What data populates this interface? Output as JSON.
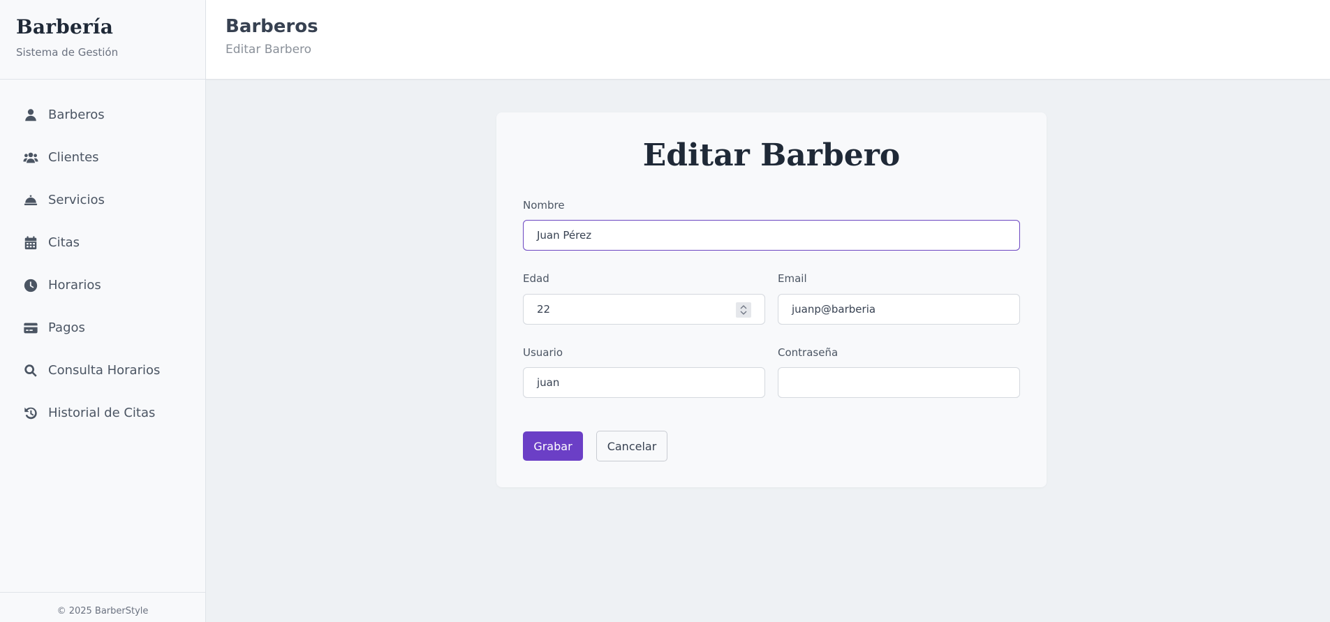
{
  "brand": {
    "title": "Barbería",
    "subtitle": "Sistema de Gestión"
  },
  "sidebar": {
    "items": [
      {
        "label": "Barberos",
        "icon": "user-icon"
      },
      {
        "label": "Clientes",
        "icon": "users-icon"
      },
      {
        "label": "Servicios",
        "icon": "concierge-bell-icon"
      },
      {
        "label": "Citas",
        "icon": "calendar-icon"
      },
      {
        "label": "Horarios",
        "icon": "clock-icon"
      },
      {
        "label": "Pagos",
        "icon": "credit-card-icon"
      },
      {
        "label": "Consulta Horarios",
        "icon": "search-icon"
      },
      {
        "label": "Historial de Citas",
        "icon": "history-icon"
      }
    ],
    "footer": "© 2025 BarberStyle"
  },
  "header": {
    "title": "Barberos",
    "subtitle": "Editar Barbero"
  },
  "form": {
    "title": "Editar Barbero",
    "nombre": {
      "label": "Nombre",
      "value": "Juan Pérez"
    },
    "edad": {
      "label": "Edad",
      "value": "22"
    },
    "email": {
      "label": "Email",
      "value": "juanp@barberia"
    },
    "usuario": {
      "label": "Usuario",
      "value": "juan"
    },
    "contrasena": {
      "label": "Contraseña",
      "value": ""
    },
    "save_label": "Grabar",
    "cancel_label": "Cancelar"
  },
  "colors": {
    "accent": "#6b3fc6",
    "focus_border": "#6b46c1",
    "background": "#eef1f4"
  }
}
